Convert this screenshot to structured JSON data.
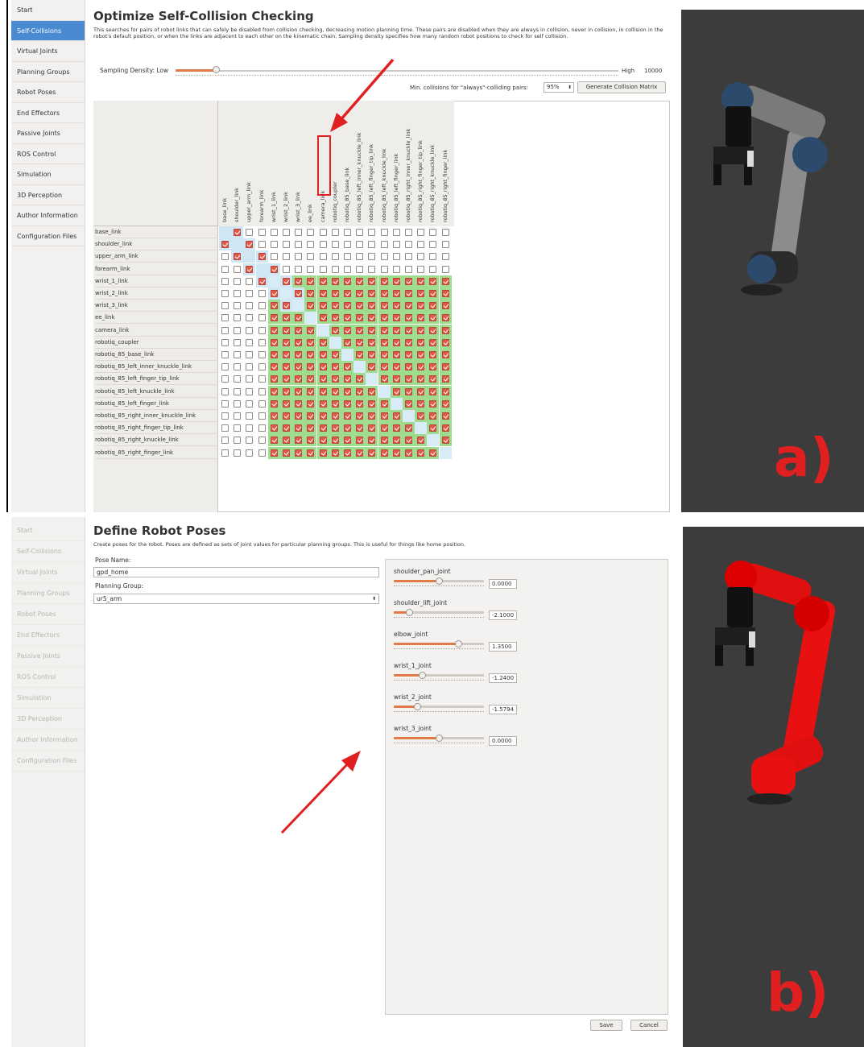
{
  "panel_a": {
    "sidebar": [
      "Start",
      "Self-Collisions",
      "Virtual Joints",
      "Planning Groups",
      "Robot Poses",
      "End Effectors",
      "Passive Joints",
      "ROS Control",
      "Simulation",
      "3D Perception",
      "Author Information",
      "Configuration Files"
    ],
    "active_index": 1,
    "title": "Optimize Self-Collision Checking",
    "description": "This searches for pairs of robot links that can safely be disabled from collision checking, decreasing motion planning time. These pairs are disabled when they are always in collision, never in collision, in collision in the robot's default position, or when the links are adjacent to each other on the kinematic chain. Sampling density specifies how many random robot positions to check for self collision.",
    "density_label": "Sampling Density: Low",
    "density_high": "High",
    "density_value": "10000",
    "density_fraction": 0.09,
    "min_collisions_label": "Min. collisions for \"always\"-colliding pairs:",
    "min_collisions_value": "95%",
    "generate_button": "Generate Collision Matrix",
    "links": [
      "base_link",
      "shoulder_link",
      "upper_arm_link",
      "forearm_link",
      "wrist_1_link",
      "wrist_2_link",
      "wrist_3_link",
      "ee_link",
      "camera_link",
      "robotiq_coupler",
      "robotiq_85_base_link",
      "robotiq_85_left_inner_knuckle_link",
      "robotiq_85_left_finger_tip_link",
      "robotiq_85_left_knuckle_link",
      "robotiq_85_left_finger_link",
      "robotiq_85_right_inner_knuckle_link",
      "robotiq_85_right_finger_tip_link",
      "robotiq_85_right_knuckle_link",
      "robotiq_85_right_finger_link"
    ],
    "label": "a)"
  },
  "panel_b": {
    "sidebar": [
      "Start",
      "Self-Collisions",
      "Virtual Joints",
      "Planning Groups",
      "Robot Poses",
      "End Effectors",
      "Passive Joints",
      "ROS Control",
      "Simulation",
      "3D Perception",
      "Author Information",
      "Configuration Files"
    ],
    "title": "Define Robot Poses",
    "description": "Create poses for the robot. Poses are defined as sets of joint values for particular planning groups. This is useful for things like home position.",
    "pose_name_label": "Pose Name:",
    "pose_name_value": "gpd_home",
    "planning_group_label": "Planning Group:",
    "planning_group_value": "ur5_arm",
    "joints": [
      {
        "name": "shoulder_pan_joint",
        "value": "0.0000",
        "fraction": 0.5
      },
      {
        "name": "shoulder_lift_joint",
        "value": "-2.1000",
        "fraction": 0.17
      },
      {
        "name": "elbow_joint",
        "value": "1.3500",
        "fraction": 0.71
      },
      {
        "name": "wrist_1_joint",
        "value": "-1.2400",
        "fraction": 0.31
      },
      {
        "name": "wrist_2_joint",
        "value": "-1.5794",
        "fraction": 0.26
      },
      {
        "name": "wrist_3_joint",
        "value": "0.0000",
        "fraction": 0.5
      }
    ],
    "save_button": "Save",
    "cancel_button": "Cancel",
    "label": "b)"
  },
  "colors": {
    "accent": "#e07a47",
    "active": "#4a8ad0",
    "annotation": "#e02020",
    "disabled_green": "#9fdc8f"
  }
}
